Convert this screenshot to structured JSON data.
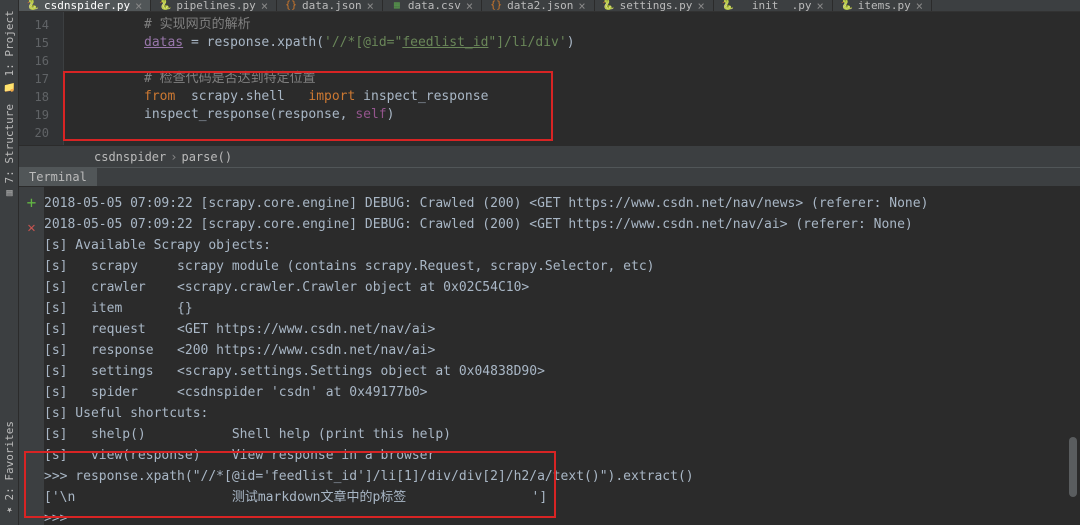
{
  "left_tabs": {
    "top": [
      {
        "label": "1: Project",
        "icon": "📁"
      },
      {
        "label": "7: Structure",
        "icon": "▤"
      }
    ],
    "bottom": [
      {
        "label": "2: Favorites",
        "icon": "★"
      }
    ]
  },
  "tabs": [
    {
      "label": "csdnspider.py",
      "type": "py",
      "active": true
    },
    {
      "label": "pipelines.py",
      "type": "py",
      "active": false
    },
    {
      "label": "data.json",
      "type": "json",
      "active": false
    },
    {
      "label": "data.csv",
      "type": "csv",
      "active": false
    },
    {
      "label": "data2.json",
      "type": "json",
      "active": false
    },
    {
      "label": "settings.py",
      "type": "py",
      "active": false
    },
    {
      "label": "__init__.py",
      "type": "py",
      "active": false
    },
    {
      "label": "items.py",
      "type": "py",
      "active": false
    }
  ],
  "editor": {
    "lines_start": 14,
    "code": [
      {
        "seg": [
          {
            "t": "# 实现网页的解析",
            "cls": "cm"
          }
        ]
      },
      {
        "seg": [
          {
            "t": "datas",
            "cls": "var-underline"
          },
          {
            "t": " = response.",
            "cls": "var"
          },
          {
            "t": "xpath",
            "cls": "var"
          },
          {
            "t": "(",
            "cls": "var"
          },
          {
            "t": "'//*[@id=\"",
            "cls": "str"
          },
          {
            "t": "feedlist_id",
            "cls": "str-link"
          },
          {
            "t": "\"]/li/div'",
            "cls": "str"
          },
          {
            "t": ")",
            "cls": "var"
          }
        ]
      },
      {
        "seg": []
      },
      {
        "seg": [
          {
            "t": "# 检查代码是否达到特定位置",
            "cls": "cm"
          }
        ]
      },
      {
        "seg": [
          {
            "t": "from  ",
            "cls": "kw"
          },
          {
            "t": "scrapy.shell   ",
            "cls": "var"
          },
          {
            "t": "import",
            "cls": "kw"
          },
          {
            "t": " inspect_response",
            "cls": "var"
          }
        ]
      },
      {
        "seg": [
          {
            "t": "inspect_response(response,",
            "cls": "var"
          },
          {
            "t": " self",
            "cls": "self"
          },
          {
            "t": ")",
            "cls": "var"
          }
        ]
      },
      {
        "seg": []
      }
    ]
  },
  "breadcrumb": {
    "items": [
      "csdnspider",
      "parse()"
    ]
  },
  "terminal": {
    "tab_label": "Terminal",
    "lines": [
      "2018-05-05 07:09:22 [scrapy.core.engine] DEBUG: Crawled (200) <GET https://www.csdn.net/nav/news> (referer: None)",
      "2018-05-05 07:09:22 [scrapy.core.engine] DEBUG: Crawled (200) <GET https://www.csdn.net/nav/ai> (referer: None)",
      "[s] Available Scrapy objects:",
      "[s]   scrapy     scrapy module (contains scrapy.Request, scrapy.Selector, etc)",
      "[s]   crawler    <scrapy.crawler.Crawler object at 0x02C54C10>",
      "[s]   item       {}",
      "[s]   request    <GET https://www.csdn.net/nav/ai>",
      "[s]   response   <200 https://www.csdn.net/nav/ai>",
      "[s]   settings   <scrapy.settings.Settings object at 0x04838D90>",
      "[s]   spider     <csdnspider 'csdn' at 0x49177b0>",
      "[s] Useful shortcuts:",
      "[s]   shelp()           Shell help (print this help)",
      "[s]   view(response)    View response in a browser",
      ">>> response.xpath(\"//*[@id='feedlist_id']/li[1]/div/div[2]/h2/a/text()\").extract()",
      "['\\n                    测试markdown文章中的p标签                ']",
      ">>>"
    ]
  }
}
